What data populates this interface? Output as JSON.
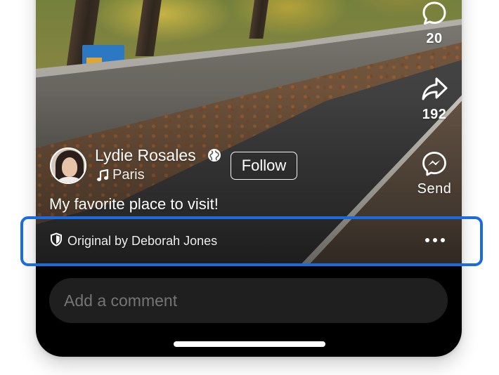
{
  "post": {
    "author_name": "Lydie Rosales",
    "location": "Paris",
    "follow_label": "Follow",
    "caption": "My favorite place to visit!",
    "original_credit": "Original by Deborah Jones"
  },
  "actions": {
    "comments_count": "20",
    "shares_count": "192",
    "send_label": "Send"
  },
  "comment_bar": {
    "placeholder": "Add a comment"
  },
  "icons": {
    "comment": "comment-bubble-icon",
    "share": "share-arrow-icon",
    "send": "messenger-icon",
    "globe": "globe-icon",
    "music": "music-note-icon",
    "shield": "shield-icon",
    "more": "more-dots-icon"
  },
  "colors": {
    "highlight": "#1a6be0",
    "phone_background": "#000000",
    "comment_bar_background": "#1f1f1f"
  }
}
